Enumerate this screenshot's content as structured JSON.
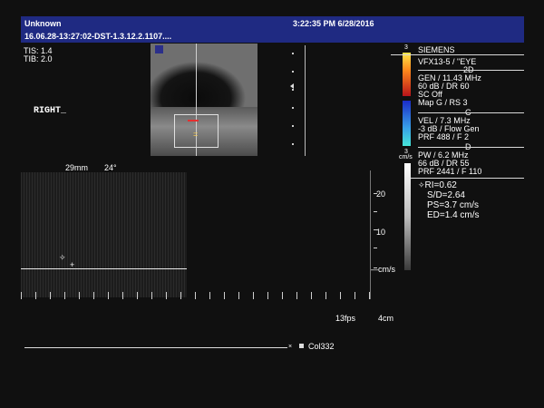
{
  "header": {
    "patient": "Unknown",
    "datetime": "3:22:35 PM 6/28/2016",
    "study_id": "16.06.28-13:27:02-DST-1.3.12.2.1107...."
  },
  "indices": {
    "tis": "TIS: 1.4",
    "tib": "TIB: 2.0"
  },
  "side_label": "RIGHT_",
  "scale_marker": "3",
  "params": {
    "vendor": "SIEMENS",
    "probe": "VFX13-5 / \"EYE",
    "sec_2d": "2D",
    "gen": "GEN / 11.43 MHz",
    "db_dr": "60 dB / DR 60",
    "sc": "SC Off",
    "map": "Map G / RS 3",
    "sec_c": "C",
    "vel": "VEL / 7.3 MHz",
    "flow": "-3 dB / Flow Gen",
    "prf_c": "PRF 488 / F 2",
    "sec_d": "D",
    "pw": "PW / 6.2 MHz",
    "pw_db": "66 dB / DR 55",
    "prf_d": "PRF 2441 / F 110"
  },
  "color_bar": {
    "top": "3",
    "bottom": "3",
    "unit": "cm/s"
  },
  "measurements": {
    "ri": "RI=0.62",
    "sd": "S/D=2.64",
    "ps": "PS=3.7 cm/s",
    "ed": "ED=1.4 cm/s"
  },
  "doppler": {
    "depth": "29mm",
    "angle": "24°",
    "scale_20": "20",
    "scale_10": "10",
    "unit": "cm/s"
  },
  "footer": {
    "fps": "13fps",
    "depth": "4cm",
    "colormap": "Col332"
  },
  "colors": {
    "title_bg": "#1f2a82",
    "gate_box": "#e0e0e0",
    "measure_cursor": "#ffffff"
  }
}
